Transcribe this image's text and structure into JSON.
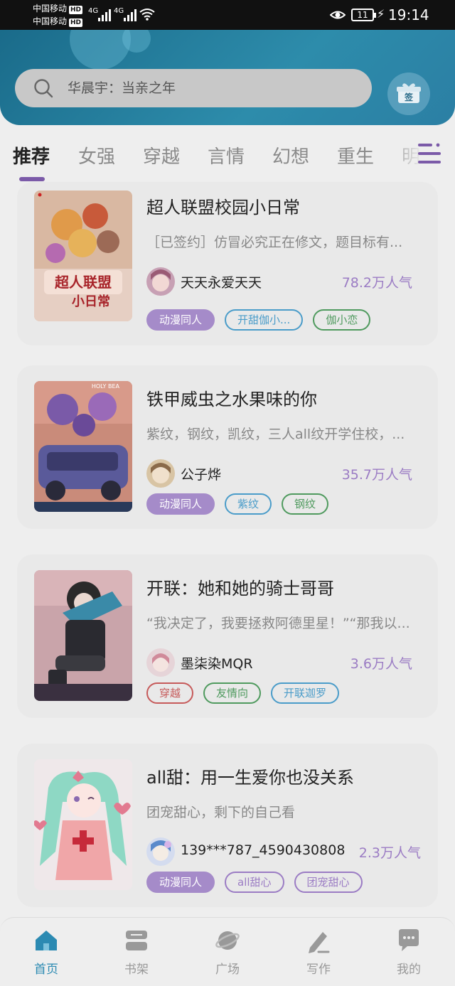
{
  "status_bar": {
    "carrier1": "中国移动",
    "carrier2": "中国移动",
    "hd": "HD",
    "net": "4G",
    "battery": "11",
    "time": "19:14"
  },
  "header": {
    "search_placeholder": "华晨宇：当亲之年",
    "checkin_label": "签"
  },
  "tabs": [
    "推荐",
    "女强",
    "穿越",
    "言情",
    "幻想",
    "重生",
    "明"
  ],
  "active_tab": 0,
  "books": [
    {
      "title": "超人联盟校园小日常",
      "desc": "［已签约］仿冒必究正在修文，题目标有...",
      "author": "天天永爱天天",
      "popularity": "78.2万人气",
      "tags": [
        {
          "label": "动漫同人",
          "style": "filled",
          "color": "#a58bc9"
        },
        {
          "label": "开甜伽小...",
          "style": "outline",
          "color": "#4a9cc9"
        },
        {
          "label": "伽小恋",
          "style": "outline",
          "color": "#4f9a5e"
        }
      ]
    },
    {
      "title": "铁甲威虫之水果味的你",
      "desc": "紫纹，钢纹，凯纹，三人all纹开学住校，...",
      "author": "公子烨",
      "popularity": "35.7万人气",
      "tags": [
        {
          "label": "动漫同人",
          "style": "filled",
          "color": "#a58bc9"
        },
        {
          "label": "紫纹",
          "style": "outline",
          "color": "#4a9cc9"
        },
        {
          "label": "钢纹",
          "style": "outline",
          "color": "#4f9a5e"
        }
      ]
    },
    {
      "title": "开联：她和她的骑士哥哥",
      "desc": "“我决定了，我要拯救阿德里星！”“那我以...",
      "author": "墨柒染MQR",
      "popularity": "3.6万人气",
      "tags": [
        {
          "label": "穿越",
          "style": "outline",
          "color": "#c65a5a"
        },
        {
          "label": "友情向",
          "style": "outline",
          "color": "#4f9a5e"
        },
        {
          "label": "开联迦罗",
          "style": "outline",
          "color": "#4a9cc9"
        }
      ]
    },
    {
      "title": "all甜：用一生爱你也没关系",
      "desc": "团宠甜心，剩下的自己看",
      "author": "139***787_4590430808",
      "popularity": "2.3万人气",
      "tags": [
        {
          "label": "动漫同人",
          "style": "filled",
          "color": "#a58bc9"
        },
        {
          "label": "all甜心",
          "style": "outline",
          "color": "#9b7cc4"
        },
        {
          "label": "团宠甜心",
          "style": "outline",
          "color": "#9b7cc4"
        }
      ]
    }
  ],
  "bottom_nav": [
    {
      "label": "首页",
      "icon": "home-icon"
    },
    {
      "label": "书架",
      "icon": "bookshelf-icon"
    },
    {
      "label": "广场",
      "icon": "planet-icon"
    },
    {
      "label": "写作",
      "icon": "pen-icon"
    },
    {
      "label": "我的",
      "icon": "chat-icon"
    }
  ],
  "colors": {
    "accent": "#7b5aa8",
    "nav_active": "#2b8ab2",
    "popularity": "#9b7cc4"
  }
}
